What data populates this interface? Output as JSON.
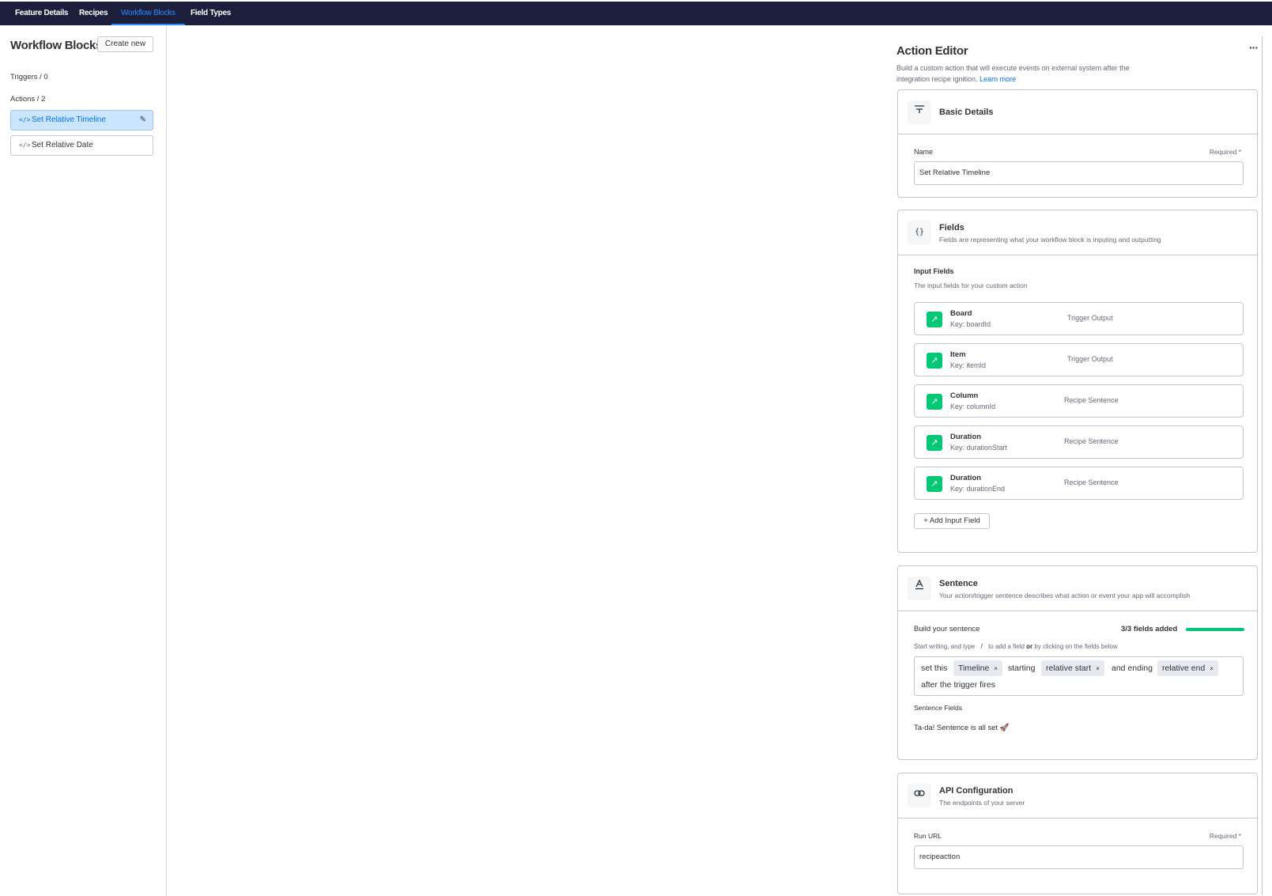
{
  "nav": {
    "tabs": [
      {
        "label": "Feature Details"
      },
      {
        "label": "Recipes"
      },
      {
        "label": "Workflow Blocks"
      },
      {
        "label": "Field Types"
      }
    ]
  },
  "sidebar": {
    "title": "Workflow Blocks",
    "create_label": "Create new",
    "triggers_label": "Triggers / 0",
    "actions_label": "Actions / 2",
    "items": [
      {
        "label": "Set Relative Timeline",
        "active": true
      },
      {
        "label": "Set Relative Date",
        "active": false
      }
    ]
  },
  "editor": {
    "title": "Action Editor",
    "more_label": "···",
    "subtitle": "Build a custom action that will execute events on external system after the integration recipe ignition.",
    "learn_more": "Learn more",
    "basic": {
      "title": "Basic Details",
      "name_label": "Name",
      "required": "Required *",
      "name_value": "Set Relative Timeline"
    },
    "fields": {
      "title": "Fields",
      "subtitle": "Fields are representing what your workflow block is inputing and outputting",
      "input_title": "Input Fields",
      "input_sub": "The input fields for your custom action",
      "items": [
        {
          "name": "Board",
          "key": "Key: boardId",
          "source": "Trigger Output"
        },
        {
          "name": "Item",
          "key": "Key: itemId",
          "source": "Trigger Output"
        },
        {
          "name": "Column",
          "key": "Key: columnId",
          "source": "Recipe Sentence"
        },
        {
          "name": "Duration",
          "key": "Key: durationStart",
          "source": "Recipe Sentence"
        },
        {
          "name": "Duration",
          "key": "Key: durationEnd",
          "source": "Recipe Sentence"
        }
      ],
      "add_label": "+ Add Input Field"
    },
    "sentence": {
      "title": "Sentence",
      "subtitle": "Your action/trigger sentence describes what action or event your app will accomplish",
      "build_label": "Build your sentence",
      "count": "3/3 fields added",
      "progress": 1.0,
      "hint_a": "Start writing, and type",
      "hint_slash": "/",
      "hint_b": "to add a field",
      "hint_or": "or",
      "hint_c": "by clicking on the fields below",
      "words": {
        "w1": "set this",
        "chip1": "Timeline",
        "w2": "starting",
        "chip2": "relative start",
        "w3": "and ending",
        "chip3": "relative end",
        "w4": "after the trigger fires"
      },
      "chip_close": "×",
      "fields_label": "Sentence Fields",
      "done": "Ta-da! Sentence is all set 🚀"
    },
    "api": {
      "title": "API Configuration",
      "subtitle": "The endpoints of your server",
      "run_label": "Run URL",
      "required": "Required *",
      "run_value": "recipeaction"
    }
  },
  "colors": {
    "nav_bg": "#1c1f3b",
    "accent": "#0073ea",
    "success": "#00c875",
    "border": "#c3c6d4"
  }
}
